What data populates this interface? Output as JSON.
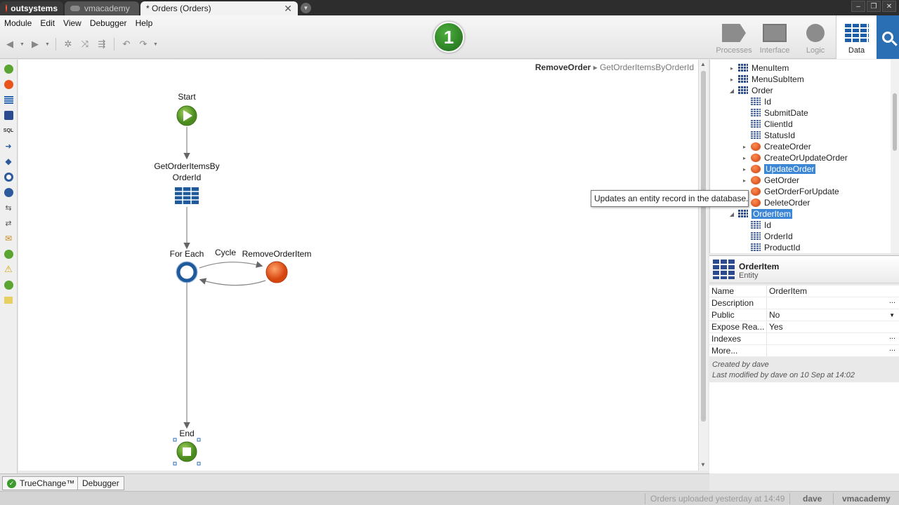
{
  "window": {
    "brand": "outsystems",
    "tabs": [
      {
        "label": "vmacademy"
      },
      {
        "label": "* Orders (Orders)"
      }
    ]
  },
  "menu": [
    "Module",
    "Edit",
    "View",
    "Debugger",
    "Help"
  ],
  "step_badge": "1",
  "layer_tabs": [
    {
      "label": "Processes",
      "icon": "process-icon"
    },
    {
      "label": "Interface",
      "icon": "interface-icon"
    },
    {
      "label": "Logic",
      "icon": "logic-icon"
    },
    {
      "label": "Data",
      "icon": "data-icon",
      "active": true
    }
  ],
  "breadcrumb": {
    "current": "RemoveOrder",
    "separator": "▸",
    "child": "GetOrderItemsByOrderId"
  },
  "flow": {
    "start": "Start",
    "aggregate_line1": "GetOrderItemsBy",
    "aggregate_line2": "OrderId",
    "foreach": "For Each",
    "cycle": "Cycle",
    "remove": "RemoveOrderItem",
    "end": "End"
  },
  "tree": {
    "rows": [
      {
        "label": "MenuItem",
        "level": 0,
        "exp": "▸",
        "icon": "entity"
      },
      {
        "label": "MenuSubItem",
        "level": 0,
        "exp": "▸",
        "icon": "entity"
      },
      {
        "label": "Order",
        "level": 0,
        "exp": "◢",
        "icon": "entity"
      },
      {
        "label": "Id",
        "level": 1,
        "exp": "",
        "icon": "attr"
      },
      {
        "label": "SubmitDate",
        "level": 1,
        "exp": "",
        "icon": "attr"
      },
      {
        "label": "ClientId",
        "level": 1,
        "exp": "",
        "icon": "attr"
      },
      {
        "label": "StatusId",
        "level": 1,
        "exp": "",
        "icon": "attr"
      },
      {
        "label": "CreateOrder",
        "level": 1,
        "exp": "▸",
        "icon": "action"
      },
      {
        "label": "CreateOrUpdateOrder",
        "level": 1,
        "exp": "▸",
        "icon": "action"
      },
      {
        "label": "UpdateOrder",
        "level": 1,
        "exp": "▸",
        "icon": "action",
        "selected": true
      },
      {
        "label": "GetOrder",
        "level": 1,
        "exp": "▸",
        "icon": "action"
      },
      {
        "label": "GetOrderForUpdate",
        "level": 1,
        "exp": "",
        "icon": "action"
      },
      {
        "label": "DeleteOrder",
        "level": 1,
        "exp": "",
        "icon": "action"
      },
      {
        "label": "OrderItem",
        "level": 0,
        "exp": "◢",
        "icon": "entity",
        "selected": true
      },
      {
        "label": "Id",
        "level": 1,
        "exp": "",
        "icon": "attr"
      },
      {
        "label": "OrderId",
        "level": 1,
        "exp": "",
        "icon": "attr"
      },
      {
        "label": "ProductId",
        "level": 1,
        "exp": "",
        "icon": "attr"
      }
    ],
    "tooltip": "Updates an entity record in the database."
  },
  "properties": {
    "name": "OrderItem",
    "type": "Entity",
    "rows": [
      {
        "key": "Name",
        "value": "OrderItem",
        "control": ""
      },
      {
        "key": "Description",
        "value": "",
        "control": "..."
      },
      {
        "key": "Public",
        "value": "No",
        "control": "▼"
      },
      {
        "key": "Expose Rea...",
        "value": "Yes",
        "control": ""
      },
      {
        "key": "Indexes",
        "value": "",
        "control": "..."
      },
      {
        "key": "More...",
        "value": "",
        "control": "..."
      }
    ],
    "created": "Created by dave",
    "modified": "Last modified by dave on 10 Sep at 14:02"
  },
  "bottom_tabs": [
    {
      "label": "TrueChange™"
    },
    {
      "label": "Debugger"
    }
  ],
  "status": {
    "message": "Orders uploaded yesterday at 14:49",
    "user": "dave",
    "server": "vmacademy"
  },
  "colors": {
    "accent": "#3c86d6",
    "brand_green": "#3d9a2c",
    "action_orange": "#e8541a",
    "entity_blue": "#2c4b8f"
  }
}
